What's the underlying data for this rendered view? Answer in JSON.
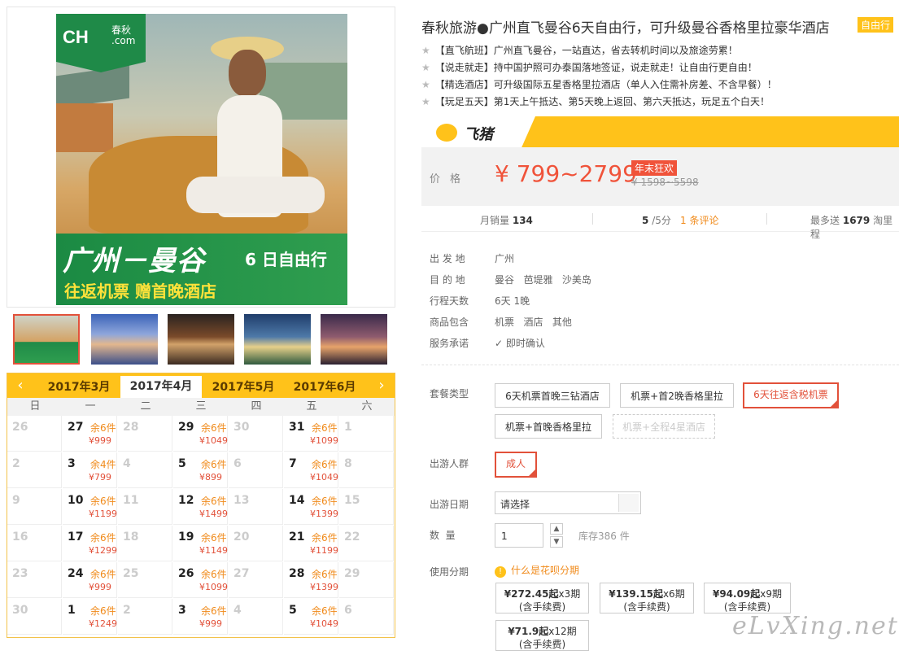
{
  "colors": {
    "accent": "#ffc21a",
    "price": "#f0533a",
    "selected": "#e2513a",
    "brand_green": "#1f8a48"
  },
  "main_image": {
    "logo_text": "CH",
    "logo_sub_1": "春秋",
    "logo_sub_2": ".com",
    "promo_title": "广州－曼谷",
    "promo_days": "6 日自由行",
    "promo_sub": "往返机票  赠首晚酒店"
  },
  "calendar": {
    "prev": "‹",
    "next": "›",
    "months": [
      "2017年3月",
      "2017年4月",
      "2017年5月",
      "2017年6月"
    ],
    "active_month_index": 1,
    "weekdays": [
      "日",
      "一",
      "二",
      "三",
      "四",
      "五",
      "六"
    ],
    "weeks": [
      [
        {
          "d": "26"
        },
        {
          "d": "27",
          "s": "余6件",
          "p": "¥999"
        },
        {
          "d": "28"
        },
        {
          "d": "29",
          "s": "余6件",
          "p": "¥1049"
        },
        {
          "d": "30"
        },
        {
          "d": "31",
          "s": "余6件",
          "p": "¥1099"
        },
        {
          "d": "1"
        }
      ],
      [
        {
          "d": "2"
        },
        {
          "d": "3",
          "s": "余4件",
          "p": "¥799"
        },
        {
          "d": "4"
        },
        {
          "d": "5",
          "s": "余6件",
          "p": "¥899"
        },
        {
          "d": "6"
        },
        {
          "d": "7",
          "s": "余6件",
          "p": "¥1049"
        },
        {
          "d": "8"
        }
      ],
      [
        {
          "d": "9"
        },
        {
          "d": "10",
          "s": "余6件",
          "p": "¥1199"
        },
        {
          "d": "11"
        },
        {
          "d": "12",
          "s": "余6件",
          "p": "¥1499"
        },
        {
          "d": "13"
        },
        {
          "d": "14",
          "s": "余6件",
          "p": "¥1399"
        },
        {
          "d": "15"
        }
      ],
      [
        {
          "d": "16"
        },
        {
          "d": "17",
          "s": "余6件",
          "p": "¥1299"
        },
        {
          "d": "18"
        },
        {
          "d": "19",
          "s": "余6件",
          "p": "¥1149"
        },
        {
          "d": "20"
        },
        {
          "d": "21",
          "s": "余6件",
          "p": "¥1199"
        },
        {
          "d": "22"
        }
      ],
      [
        {
          "d": "23"
        },
        {
          "d": "24",
          "s": "余6件",
          "p": "¥999"
        },
        {
          "d": "25"
        },
        {
          "d": "26",
          "s": "余6件",
          "p": "¥1099"
        },
        {
          "d": "27"
        },
        {
          "d": "28",
          "s": "余6件",
          "p": "¥1399"
        },
        {
          "d": "29"
        }
      ],
      [
        {
          "d": "30"
        },
        {
          "d": "1",
          "s": "余6件",
          "p": "¥1249"
        },
        {
          "d": "2"
        },
        {
          "d": "3",
          "s": "余6件",
          "p": "¥999"
        },
        {
          "d": "4"
        },
        {
          "d": "5",
          "s": "余6件",
          "p": "¥1049"
        },
        {
          "d": "6"
        }
      ]
    ]
  },
  "product": {
    "title": "春秋旅游●广州直飞曼谷6天自由行，可升级曼谷香格里拉豪华酒店",
    "tag": "自由行",
    "features": [
      "【直飞航班】广州直飞曼谷，一站直达，省去转机时间以及旅途劳累！",
      "【说走就走】持中国护照可办泰国落地签证，说走就走！让自由行更自由！",
      "【精选酒店】可升级国际五星香格里拉酒店（单人入住需补房差、不含早餐）！",
      "【玩足五天】第1天上午抵达、第5天晚上返回、第六天抵达，玩足五个白天！"
    ]
  },
  "feizhu": {
    "logo_text": "飞猪"
  },
  "price": {
    "label": "价格",
    "value": "¥ 799~2799",
    "promo": "年末狂欢",
    "original": "¥ 1598~5598"
  },
  "stats": {
    "sales_label": "月销量",
    "sales_value": "134",
    "rating_value": "5",
    "rating_suffix": "/5分",
    "reviews": "1 条评论",
    "points_prefix": "最多送",
    "points_value": "1679",
    "points_suffix": "淘里程"
  },
  "details": [
    {
      "label": "出 发 地",
      "value": "广州"
    },
    {
      "label": "目 的 地",
      "value": "曼谷   芭堤雅   沙美岛"
    },
    {
      "label": "行程天数",
      "value": "6天 1晚"
    },
    {
      "label": "商品包含",
      "value": "机票   酒店   其他"
    },
    {
      "label": "服务承诺",
      "value": "即时确认"
    }
  ],
  "package": {
    "label": "套餐类型",
    "options": [
      "6天机票首晚三钻酒店",
      "机票+首2晚香格里拉",
      "6天往返含税机票",
      "机票+首晚香格里拉",
      "机票+全程4星酒店"
    ],
    "selected_index": 2
  },
  "travelers": {
    "label": "出游人群",
    "options": [
      "成人"
    ]
  },
  "date": {
    "label": "出游日期",
    "value": "请选择"
  },
  "quantity": {
    "label": "数  量",
    "value": "1",
    "stock": "库存386 件"
  },
  "installment": {
    "label": "使用分期",
    "help": "什么是花呗分期",
    "options": [
      {
        "amount": "¥272.45起",
        "periods": "x3期",
        "fee": "(含手续费)"
      },
      {
        "amount": "¥139.15起",
        "periods": "x6期",
        "fee": "(含手续费)"
      },
      {
        "amount": "¥94.09起",
        "periods": "x9期",
        "fee": "(含手续费)"
      },
      {
        "amount": "¥71.9起",
        "periods": "x12期",
        "fee": "(含手续费)"
      }
    ]
  },
  "watermark": "eLvXing.net"
}
